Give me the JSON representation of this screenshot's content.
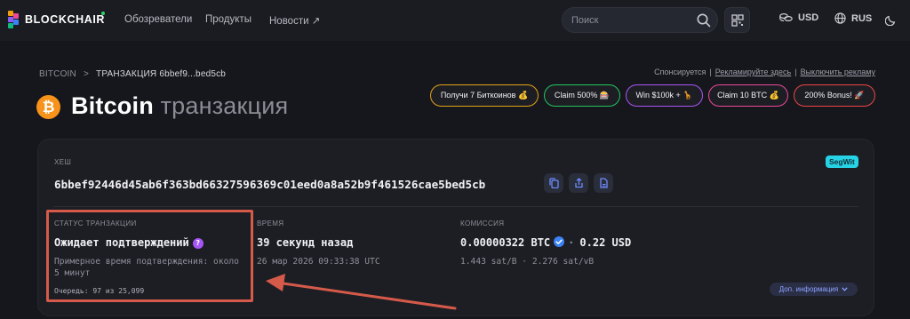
{
  "header": {
    "brand": "BLOCKCHAIR",
    "nav": [
      "Обозреватели",
      "Продукты",
      "Новости ↗"
    ],
    "search_placeholder": "Поиск",
    "currency": "USD",
    "language": "RUS"
  },
  "breadcrumb": {
    "root": "BITCOIN",
    "separator": ">",
    "current": "ТРАНЗАКЦИЯ 6bbef9...bed5cb"
  },
  "title": {
    "coin_symbol": "₿",
    "main": "Bitcoin",
    "sub": "транзакция"
  },
  "sponsor": {
    "label": "Спонсируется",
    "advertise": "Рекламируйте здесь",
    "disable": "Выключить рекламу",
    "pills": [
      {
        "label": "Получи 7 Биткоинов 💰",
        "color": "#e3a317"
      },
      {
        "label": "Claim 500% 🎰",
        "color": "#22c55e"
      },
      {
        "label": "Win $100k + 🦒",
        "color": "#a855f7"
      },
      {
        "label": "Claim 10 BTC 💰",
        "color": "#ec4899"
      },
      {
        "label": "200% Bonus! 🚀",
        "color": "#ef4444"
      }
    ]
  },
  "tx": {
    "hash_label": "ХЕШ",
    "hash": "6bbef92446d45ab6f363bd66327596369c01eed0a8a52b9f461526cae5bed5cb",
    "badge": "SegWit",
    "status_label": "СТАТУС ТРАНЗАКЦИИ",
    "status": "Ожидает подтверждений",
    "status_help": "?",
    "est_line1": "Примерное время подтверждения: около",
    "est_line2": "5 минут",
    "queue": "Очередь: 97 из 25,099",
    "time_label": "ВРЕМЯ",
    "time_ago": "39 секунд назад",
    "time_exact": "26 мар 2026 09:33:38 UTC",
    "fee_label": "КОМИССИЯ",
    "fee_btc": "0.00000322 BTC",
    "fee_dot": "·",
    "fee_usd": "0.22 USD",
    "fee_rates": "1.443 sat/B · 2.276 sat/vB",
    "more": "Доп. информация"
  },
  "colors": {
    "accent": "#f7931a",
    "annotation": "#d55a4a"
  }
}
